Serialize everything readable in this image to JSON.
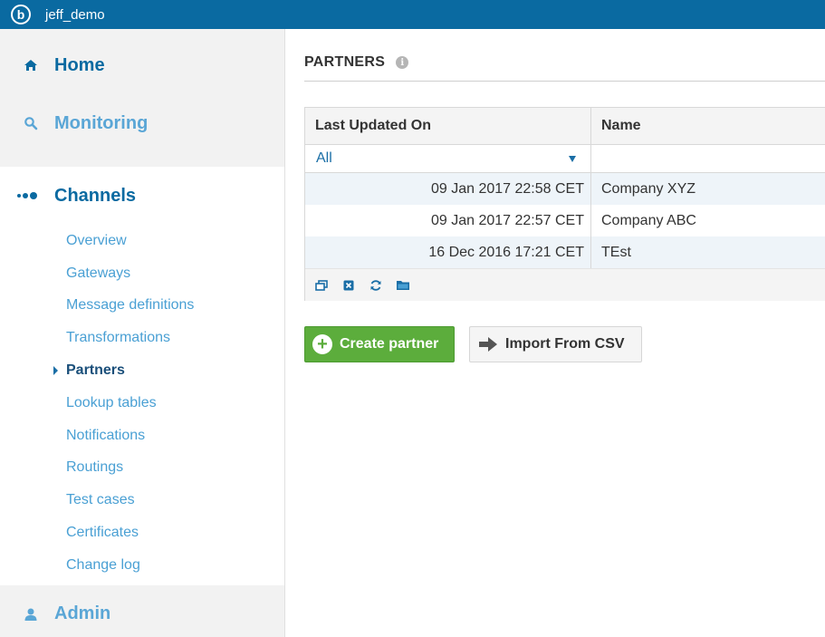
{
  "app": {
    "title": "jeff_demo",
    "logo_icon": "b-logo-icon"
  },
  "colors": {
    "topbar": "#0a6aa1",
    "accent": "#0a6aa1",
    "link": "#4aa0d4",
    "create_button": "#5cad3c"
  },
  "sidebar": {
    "home": {
      "label": "Home",
      "icon": "home-icon"
    },
    "monitoring": {
      "label": "Monitoring",
      "icon": "search-icon"
    },
    "channels": {
      "label": "Channels",
      "icon": "dots-icon",
      "items": [
        {
          "label": "Overview"
        },
        {
          "label": "Gateways"
        },
        {
          "label": "Message definitions"
        },
        {
          "label": "Transformations"
        },
        {
          "label": "Partners",
          "active": true
        },
        {
          "label": "Lookup tables"
        },
        {
          "label": "Notifications"
        },
        {
          "label": "Routings"
        },
        {
          "label": "Test cases"
        },
        {
          "label": "Certificates"
        },
        {
          "label": "Change log"
        }
      ]
    },
    "admin": {
      "label": "Admin",
      "icon": "user-icon"
    }
  },
  "main": {
    "title": "PARTNERS",
    "table": {
      "columns": [
        "Last Updated On",
        "Name"
      ],
      "filter_value": "All",
      "rows": [
        {
          "updated": "09 Jan 2017 22:58 CET",
          "name": "Company XYZ"
        },
        {
          "updated": "09 Jan 2017 22:57 CET",
          "name": "Company ABC"
        },
        {
          "updated": "16 Dec 2016 17:21 CET",
          "name": "TEst"
        }
      ],
      "toolbar_icons": [
        "restore-window-icon",
        "clear-filter-icon",
        "refresh-icon",
        "folder-icon"
      ]
    },
    "buttons": {
      "create": "Create partner",
      "import": "Import From CSV"
    }
  }
}
